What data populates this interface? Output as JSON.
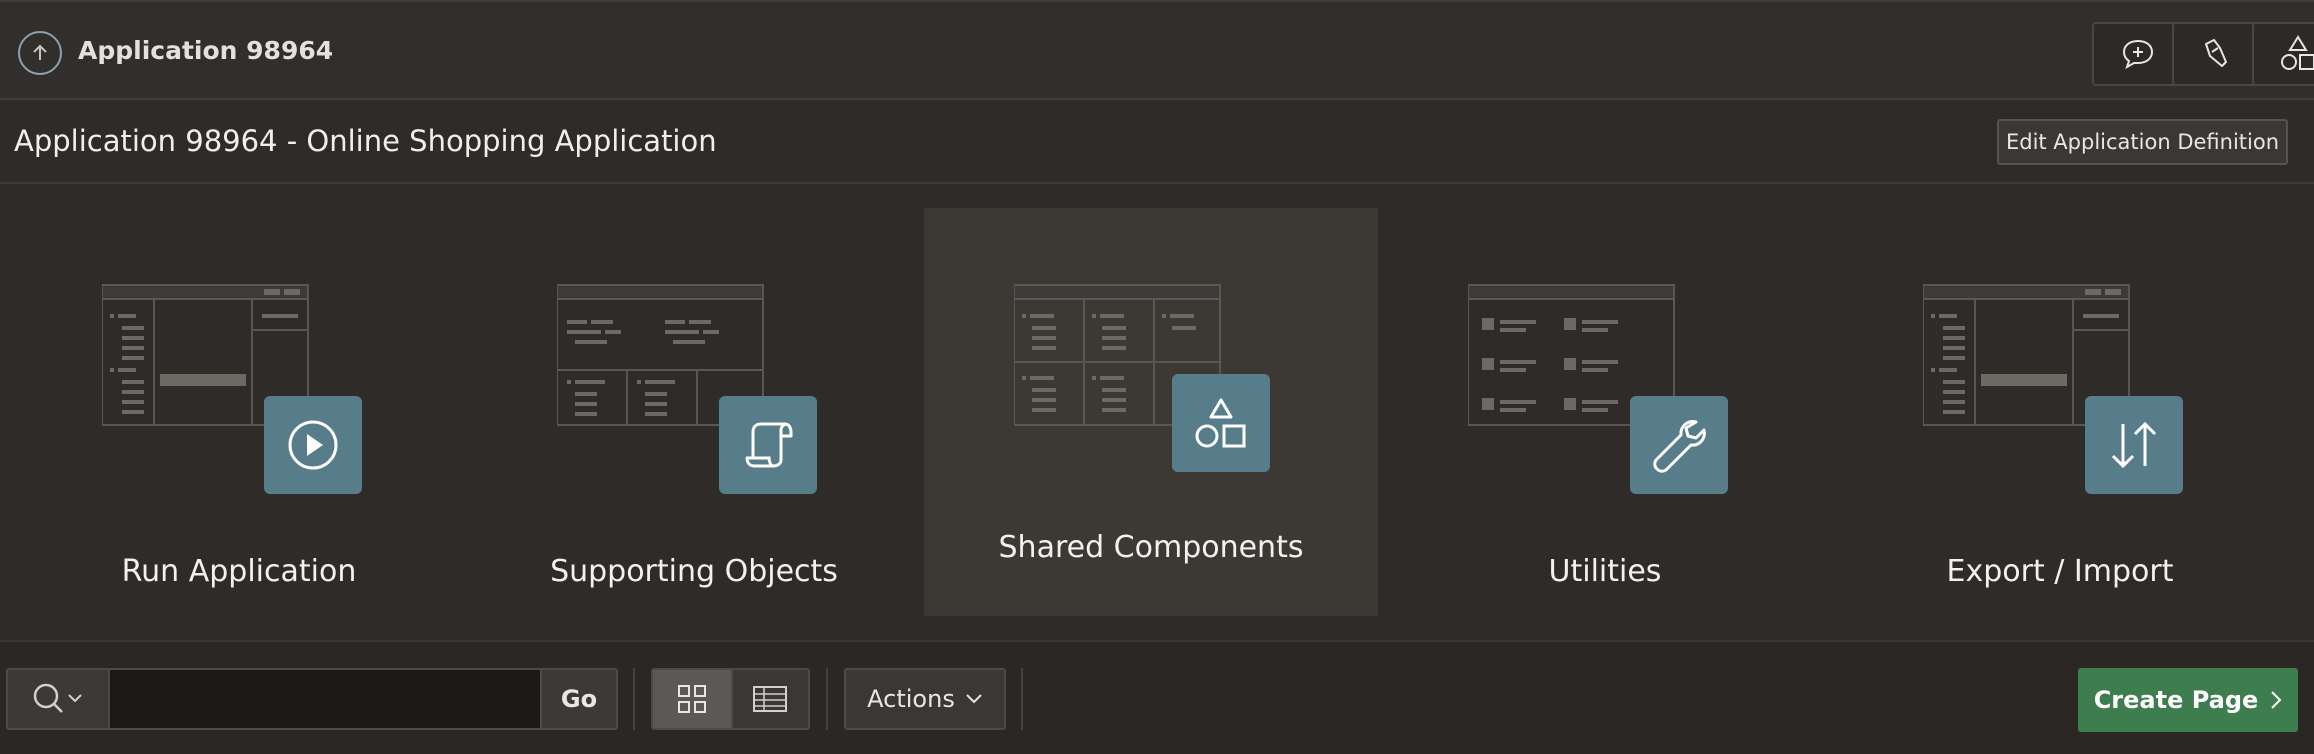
{
  "header": {
    "app_name": "Application 98964",
    "tools": [
      {
        "icon": "chat-plus-icon"
      },
      {
        "icon": "flashlight-icon"
      },
      {
        "icon": "shapes-icon"
      }
    ]
  },
  "subheader": {
    "title": "Application 98964 - Online Shopping Application",
    "edit_label": "Edit Application Definition"
  },
  "tiles": [
    {
      "label": "Run Application",
      "icon": "play-icon",
      "active": false
    },
    {
      "label": "Supporting Objects",
      "icon": "scroll-icon",
      "active": false
    },
    {
      "label": "Shared Components",
      "icon": "shapes-icon",
      "active": true
    },
    {
      "label": "Utilities",
      "icon": "wrench-icon",
      "active": false
    },
    {
      "label": "Export / Import",
      "icon": "arrows-up-down-icon",
      "active": false
    }
  ],
  "toolbar": {
    "search_value": "",
    "go_label": "Go",
    "view_mode": "icons",
    "actions_label": "Actions",
    "create_label": "Create Page"
  },
  "colors": {
    "background": "#2e2b29",
    "tile_badge": "#567d89",
    "tile_active": "#3c3935",
    "create_button": "#3e7d4e"
  }
}
